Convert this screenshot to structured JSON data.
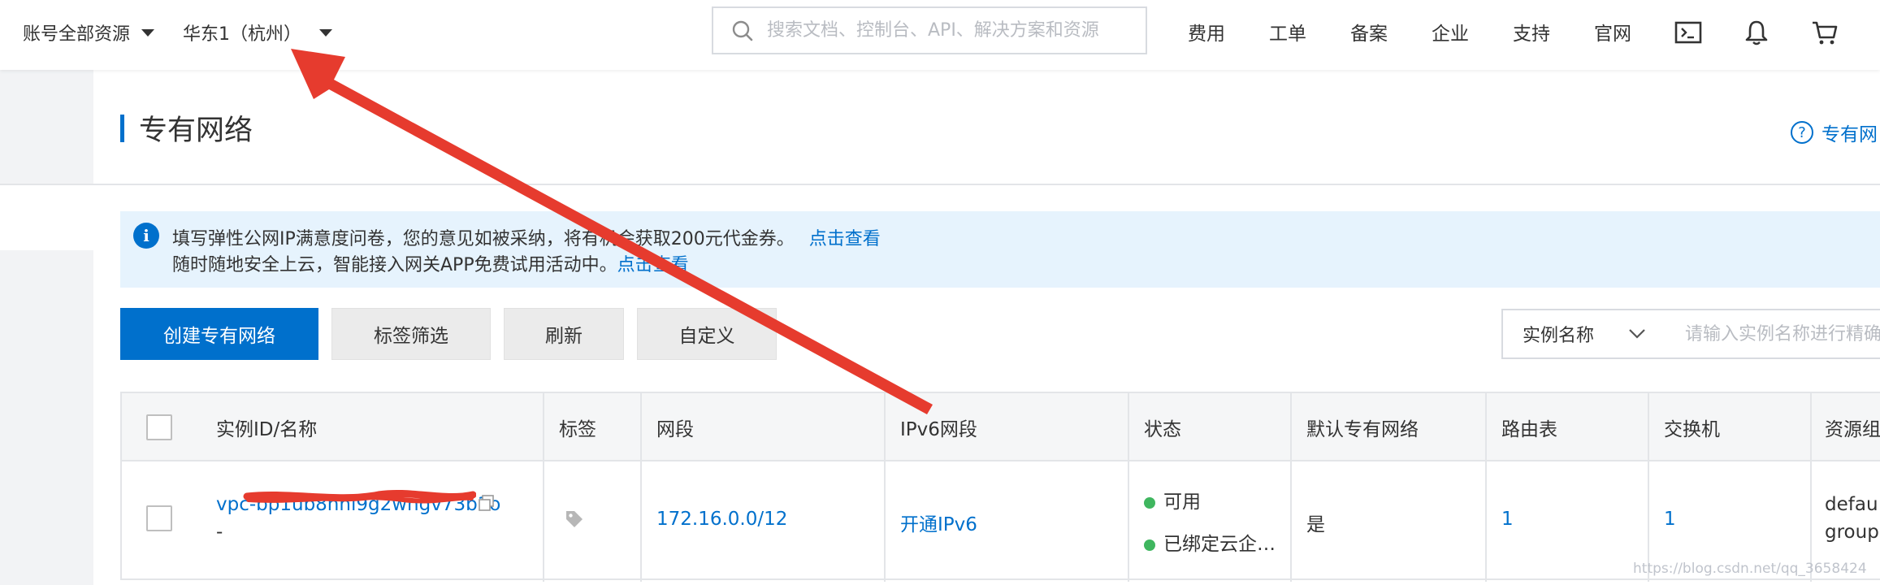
{
  "topbar": {
    "account_scope": "账号全部资源",
    "region": "华东1（杭州）",
    "search_placeholder": "搜索文档、控制台、API、解决方案和资源",
    "nav": [
      "费用",
      "工单",
      "备案",
      "企业",
      "支持",
      "官网"
    ],
    "icons": [
      "terminal-icon",
      "bell-icon",
      "cart-icon"
    ]
  },
  "page": {
    "title": "专有网络",
    "help_label": "专有网"
  },
  "notice": {
    "line1_text": "填写弹性公网IP满意度问卷，您的意见如被采纳，将有机会获取200元代金券。",
    "line1_link": "点击查看",
    "line2_text": "随时随地安全上云，智能接入网关APP免费试用活动中。",
    "line2_link": "点击查看"
  },
  "toolbar": {
    "create_label": "创建专有网络",
    "tag_filter_label": "标签筛选",
    "refresh_label": "刷新",
    "customize_label": "自定义",
    "filter_field": "实例名称",
    "filter_placeholder": "请输入实例名称进行精确查询"
  },
  "table": {
    "headers": [
      "实例ID/名称",
      "标签",
      "网段",
      "IPv6网段",
      "状态",
      "默认专有网络",
      "路由表",
      "交换机",
      "资源组"
    ],
    "rows": [
      {
        "id": "vpc-bp1ub8hhl9g2wngv73b1o",
        "name": "-",
        "cidr": "172.16.0.0/12",
        "ipv6": "开通IPv6",
        "status1": "可用",
        "status2": "已绑定云企…",
        "is_default": "是",
        "route_tables": "1",
        "vswitches": "1",
        "resource_group": [
          "defau",
          "group"
        ]
      }
    ]
  },
  "watermark": "https://blog.csdn.net/qq_3658424",
  "colors": {
    "primary": "#0070cc",
    "notice_bg": "#e6f3fd",
    "annotation_arrow": "#e63b2e",
    "status_ok": "#3fb65f"
  }
}
